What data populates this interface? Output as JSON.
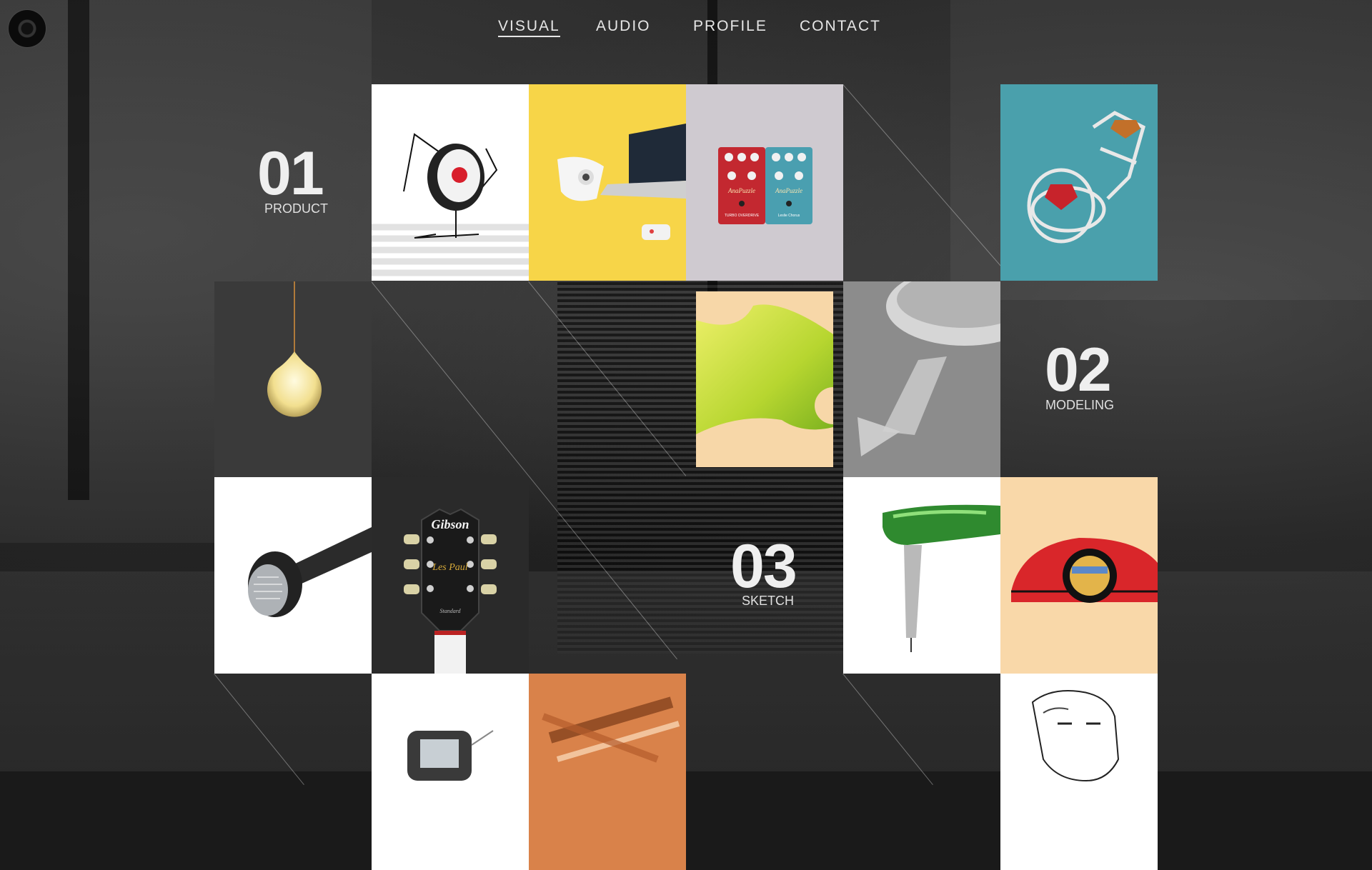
{
  "nav": {
    "items": [
      {
        "label": "VISUAL",
        "active": true
      },
      {
        "label": "AUDIO",
        "active": false
      },
      {
        "label": "PROFILE",
        "active": false
      },
      {
        "label": "CONTACT",
        "active": false
      }
    ]
  },
  "sections": [
    {
      "number": "01",
      "title": "PRODUCT"
    },
    {
      "number": "02",
      "title": "MODELING"
    },
    {
      "number": "03",
      "title": "SKETCH"
    }
  ],
  "artwork_text": {
    "guitar_brand": "Gibson",
    "guitar_model": "Les Paul",
    "guitar_sub": "Standard",
    "pedal_brand": "AnaPuzzle",
    "pedal_left": "TURBO OVERDRIVE",
    "pedal_right": "Leslie Chorus"
  },
  "tile_colors": {
    "speaker_bg": "#ffffff",
    "yellow_bg": "#f7d548",
    "pedal_bg": "#cfcad0",
    "ring_bg": "#4aa0ac",
    "lamp_bg": "#3a3a3a",
    "ginkgo_bg": "#f7d7a8",
    "wheel_bg": "#9b9b9b",
    "mic_bg": "#ffffff",
    "guitar_bg": "#2a2a2a",
    "dryer_bg": "#ffffff",
    "car_bg": "#f9d8a9",
    "sketch_bg": "#ffffff",
    "pencil_bg": "#d9824a"
  }
}
